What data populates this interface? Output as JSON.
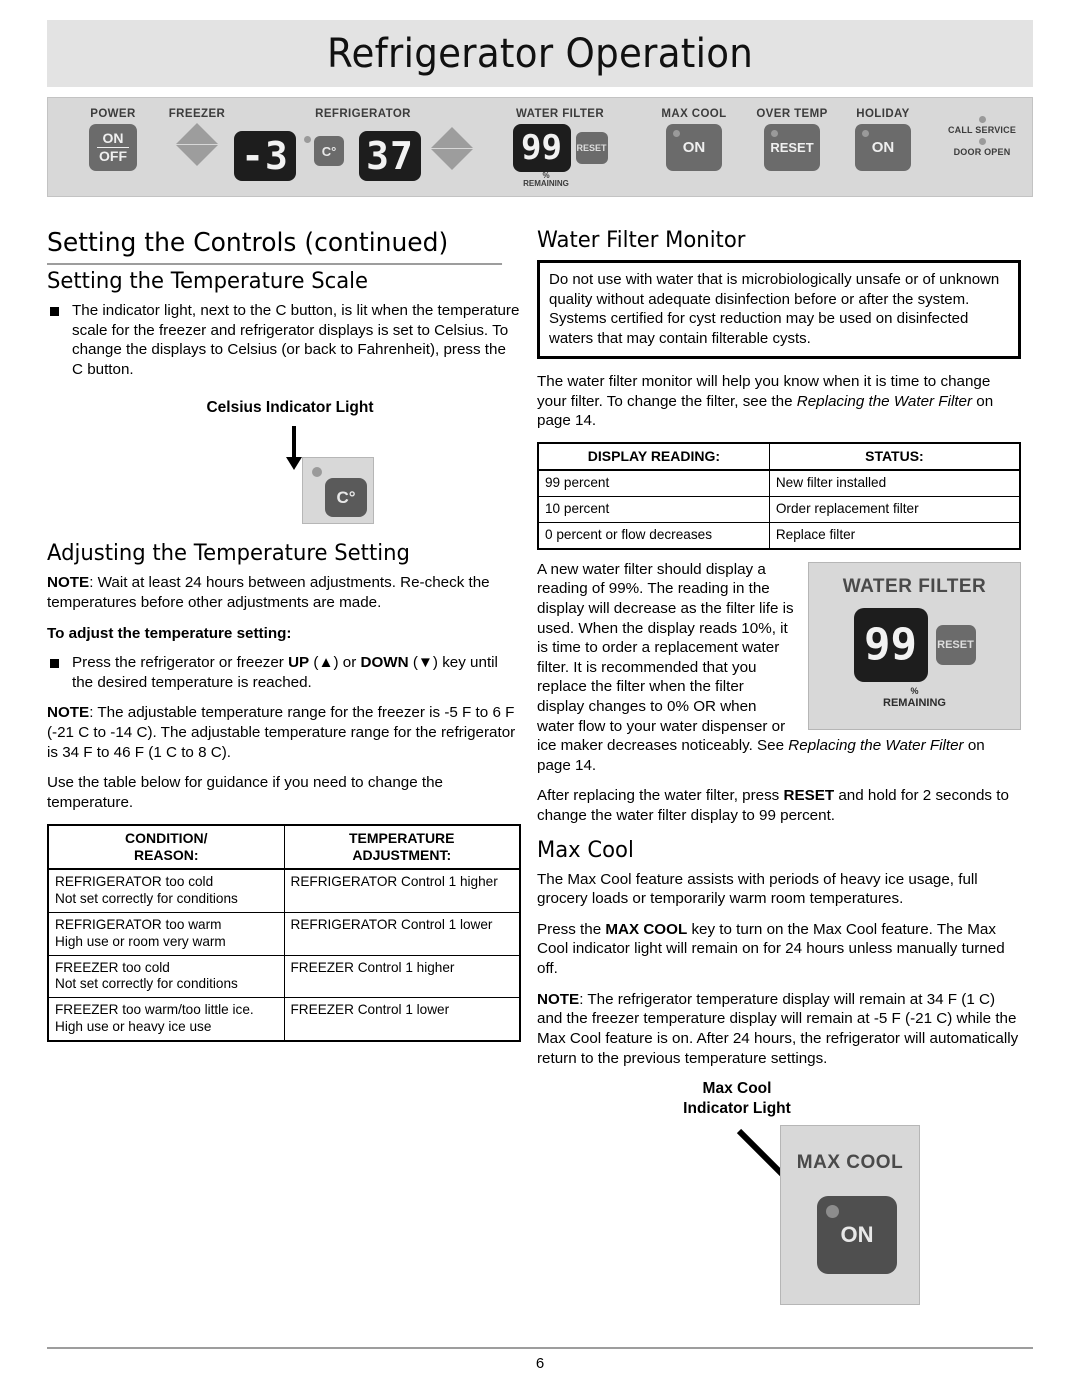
{
  "header": {
    "title": "Refrigerator Operation"
  },
  "control_panel": {
    "power": {
      "label": "POWER",
      "on": "ON",
      "off": "OFF"
    },
    "freezer": {
      "label": "FREEZER",
      "display": "-3",
      "up_icon": "triangle-up-icon",
      "down_icon": "triangle-down-icon"
    },
    "celsius": {
      "button": "C°",
      "indicator_icon": "led-dot-icon"
    },
    "refrigerator": {
      "label": "REFRIGERATOR",
      "display": "37",
      "up_icon": "triangle-up-icon",
      "down_icon": "triangle-down-icon"
    },
    "water_filter": {
      "label": "WATER FILTER",
      "display": "99",
      "reset": "RESET",
      "percent": "%",
      "remaining": "REMAINING"
    },
    "max_cool": {
      "label": "MAX COOL",
      "button": "ON"
    },
    "over_temp": {
      "label": "OVER TEMP",
      "button": "RESET"
    },
    "holiday": {
      "label": "HOLIDAY",
      "button": "ON"
    },
    "status": {
      "call_service": "CALL SERVICE",
      "door_open": "DOOR OPEN"
    }
  },
  "left": {
    "section_title": "Setting the Controls (continued)",
    "temp_scale": {
      "heading": "Setting the Temperature Scale",
      "bullet": "The indicator light, next to the C  button, is lit when the temperature scale for the freezer and refrigerator displays is set to Celsius. To change the displays to Celsius (or back to Fahrenheit), press the C  button."
    },
    "celsius_figure": {
      "caption": "Celsius Indicator Light",
      "button_label": "C°",
      "arrow_icon": "arrow-down-icon",
      "led_icon": "led-dot-icon"
    },
    "adjusting": {
      "heading": "Adjusting the Temperature Setting",
      "note1_label": "NOTE",
      "note1": ": Wait at least 24 hours between adjustments. Re-check the temperatures before other adjustments are made.",
      "subheading": "To adjust the temperature setting:",
      "bullet_pre": "Press the refrigerator or freezer ",
      "bullet_up": "UP",
      "bullet_mid1": " (▲) or ",
      "bullet_down": "DOWN",
      "bullet_post": " (▼) key until the desired temperature is reached.",
      "note2_label": "NOTE",
      "note2": ": The adjustable temperature range for the freezer is -5 F to 6 F (-21 C to -14 C). The adjustable temperature range for the refrigerator is 34 F to 46 F (1 C to 8 C).",
      "para": "Use the table below for guidance if you need to change the temperature."
    },
    "condition_table": {
      "headers": [
        "CONDITION/ REASON:",
        "TEMPERATURE ADJUSTMENT:"
      ],
      "header_lines": [
        [
          "CONDITION/",
          "REASON:"
        ],
        [
          "TEMPERATURE",
          "ADJUSTMENT:"
        ]
      ],
      "rows": [
        {
          "condition": "REFRIGERATOR too cold",
          "reason": "Not set correctly for conditions",
          "adjustment": "REFRIGERATOR Control 1  higher"
        },
        {
          "condition": "REFRIGERATOR too warm",
          "reason": "High use or room very warm",
          "adjustment": "REFRIGERATOR Control 1  lower"
        },
        {
          "condition": "FREEZER too cold",
          "reason": "Not set correctly for conditions",
          "adjustment": "FREEZER Control 1  higher"
        },
        {
          "condition": "FREEZER too warm/too little ice.",
          "reason": "High use or heavy ice use",
          "adjustment": "FREEZER Control 1  lower"
        }
      ]
    }
  },
  "right": {
    "water_filter_monitor": {
      "heading": "Water Filter Monitor",
      "warning": "Do not use with water that is microbiologically unsafe or of unknown quality without adequate disinfection before or after the system. Systems certified for cyst reduction may be used on disinfected waters that may contain filterable cysts.",
      "para1_a": "The water filter monitor will help you know when it is time to change your filter. To change the filter, see the ",
      "para1_italic": "Replacing the Water Filter",
      "para1_b": "  on page 14."
    },
    "display_table": {
      "headers": [
        "DISPLAY READING:",
        "STATUS:"
      ],
      "rows": [
        {
          "reading": "99 percent",
          "status": "New filter installed"
        },
        {
          "reading": "10 percent",
          "status": "Order replacement filter"
        },
        {
          "reading": "0 percent or flow decreases",
          "status": "Replace filter"
        }
      ]
    },
    "wf_figure": {
      "title": "WATER FILTER",
      "display": "99",
      "reset": "RESET",
      "percent": "%",
      "remaining": "REMAINING"
    },
    "wf_body_a": "A new water filter should display a reading of 99%. The reading in the display will decrease as the filter life is used. When the display reads 10%, it is time to order a replacement water filter. It is recommended that you replace the filter when the filter display changes to 0% OR when water flow to your water dispenser or ice maker decreases noticeably. See ",
    "wf_body_italic": "Replacing the Water Filter",
    "wf_body_b": " on page 14.",
    "wf_reset_para_a": "After replacing the water filter, press ",
    "wf_reset_bold": "RESET",
    "wf_reset_para_b": " and hold for 2 seconds to change the water filter display to 99 percent.",
    "max_cool": {
      "heading": "Max Cool",
      "para1": "The Max Cool feature assists with periods of heavy ice usage, full grocery loads or temporarily warm room temperatures.",
      "para2_a": "Press the ",
      "para2_bold": "MAX COOL",
      "para2_b": " key to turn on the Max Cool feature. The Max Cool indicator light will remain on for 24 hours unless manually turned off.",
      "note_label": "NOTE",
      "note": ": The refrigerator temperature display will remain at 34 F (1 C) and the freezer temperature display will remain at -5 F (-21 C) while the Max Cool feature is on. After 24 hours, the refrigerator will automatically return to the previous temperature settings."
    },
    "mc_figure": {
      "caption_line1": "Max Cool",
      "caption_line2": "Indicator Light",
      "title": "MAX COOL",
      "button": "ON",
      "arrow_icon": "arrow-diagonal-icon",
      "led_icon": "led-dot-icon"
    }
  },
  "footer": {
    "page_number": "6"
  }
}
